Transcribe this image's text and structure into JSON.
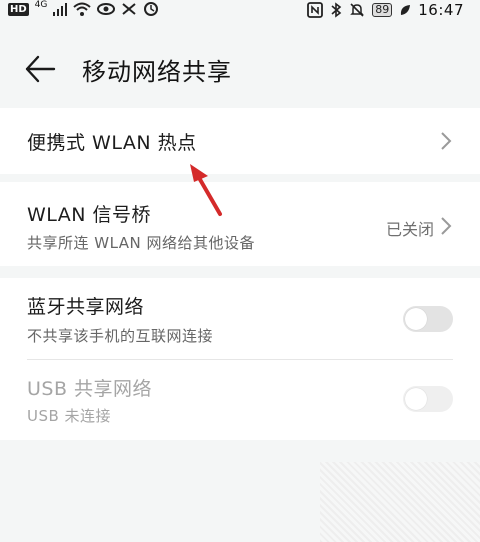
{
  "status_bar": {
    "left_icons": [
      "hd-icon",
      "4g-signal-icon",
      "wifi-icon",
      "eye-icon",
      "vpn-icon",
      "sync-icon"
    ],
    "hd_label": "HD",
    "network_label": "4G",
    "right_icons": [
      "nfc-icon",
      "bluetooth-icon",
      "mute-icon"
    ],
    "battery": "89",
    "time": "16:47"
  },
  "header": {
    "title": "移动网络共享"
  },
  "items": {
    "hotspot": {
      "label": "便携式 WLAN 热点"
    },
    "bridge": {
      "label": "WLAN 信号桥",
      "subtitle": "共享所连 WLAN 网络给其他设备",
      "value": "已关闭"
    },
    "bt": {
      "label": "蓝牙共享网络",
      "subtitle": "不共享该手机的互联网连接",
      "state": "off"
    },
    "usb": {
      "label": "USB 共享网络",
      "subtitle": "USB 未连接",
      "state": "off",
      "enabled": false
    }
  },
  "colors": {
    "background": "#f4f6f6",
    "card": "#ffffff",
    "arrow": "#d42a2a",
    "toggle_off": "#e3e3e3"
  }
}
